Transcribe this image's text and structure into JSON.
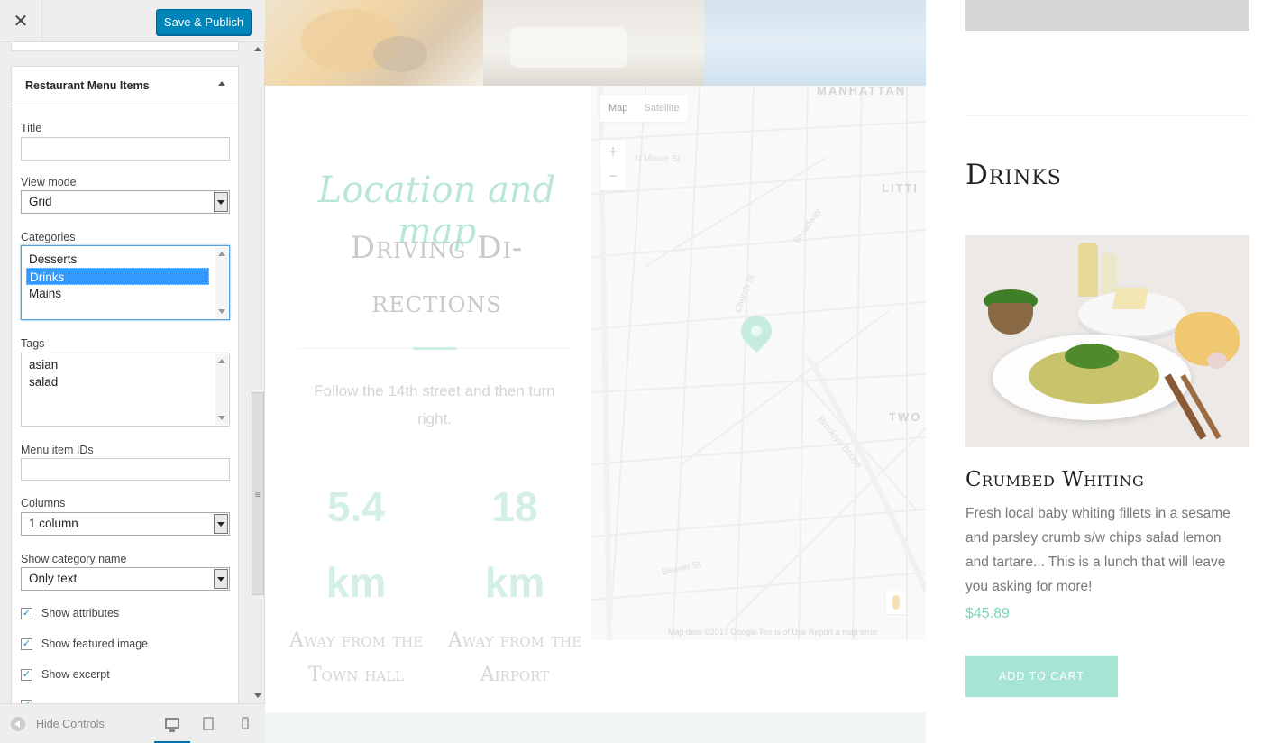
{
  "header": {
    "close_label": "✕",
    "save_label": "Save & Publish"
  },
  "widget": {
    "title": "Restaurant Menu Items",
    "fields": {
      "title_label": "Title",
      "title_value": "",
      "view_mode_label": "View mode",
      "view_mode_value": "Grid",
      "categories_label": "Categories",
      "categories": [
        {
          "label": "Desserts",
          "selected": false
        },
        {
          "label": "Drinks",
          "selected": true
        },
        {
          "label": "Mains",
          "selected": false
        }
      ],
      "tags_label": "Tags",
      "tags": [
        "asian",
        "salad"
      ],
      "menu_ids_label": "Menu item IDs",
      "menu_ids_value": "",
      "columns_label": "Columns",
      "columns_value": "1 column",
      "show_category_label": "Show category name",
      "show_category_value": "Only text",
      "checkboxes": [
        {
          "label": "Show attributes",
          "checked": true
        },
        {
          "label": "Show featured image",
          "checked": true
        },
        {
          "label": "Show excerpt",
          "checked": true
        }
      ]
    }
  },
  "footer": {
    "hide_controls_label": "Hide Controls",
    "devices": [
      "desktop-icon",
      "tablet-icon",
      "mobile-icon"
    ]
  },
  "preview": {
    "location_script": "Location and map",
    "location_title": "Driving Di-rections",
    "location_text": "Follow the 14th street and then turn right.",
    "stats": [
      {
        "value": "5.4",
        "unit": "km",
        "label": "Away from the Town hall"
      },
      {
        "value": "18",
        "unit": "km",
        "label": "Away from the Airport"
      }
    ],
    "map": {
      "type_map": "Map",
      "type_satellite": "Satellite",
      "zoom_in": "+",
      "zoom_out": "−",
      "labels": {
        "manhattan": "MANHATTAN",
        "litti": "LITTI",
        "two": "TWO",
        "moore": "N Moore St",
        "broadway": "Broadway",
        "brooklyn": "Brooklyn Bridge",
        "church": "Church St",
        "beaver": "Beaver St"
      },
      "footer": "Map data ©2017 Google    Terms of Use    Report a map error"
    }
  },
  "menu": {
    "section_title": "Drinks",
    "item": {
      "name": "Crumbed Whiting",
      "description": "Fresh local baby whiting fillets in a sesame and parsley crumb s/w chips salad lemon and tartare... This is a lunch that will leave you asking for more!",
      "price": "$45.89",
      "cart_label": "ADD TO CART"
    }
  },
  "colors": {
    "accent": "#0085ba",
    "mint": "#a6e4d3"
  }
}
